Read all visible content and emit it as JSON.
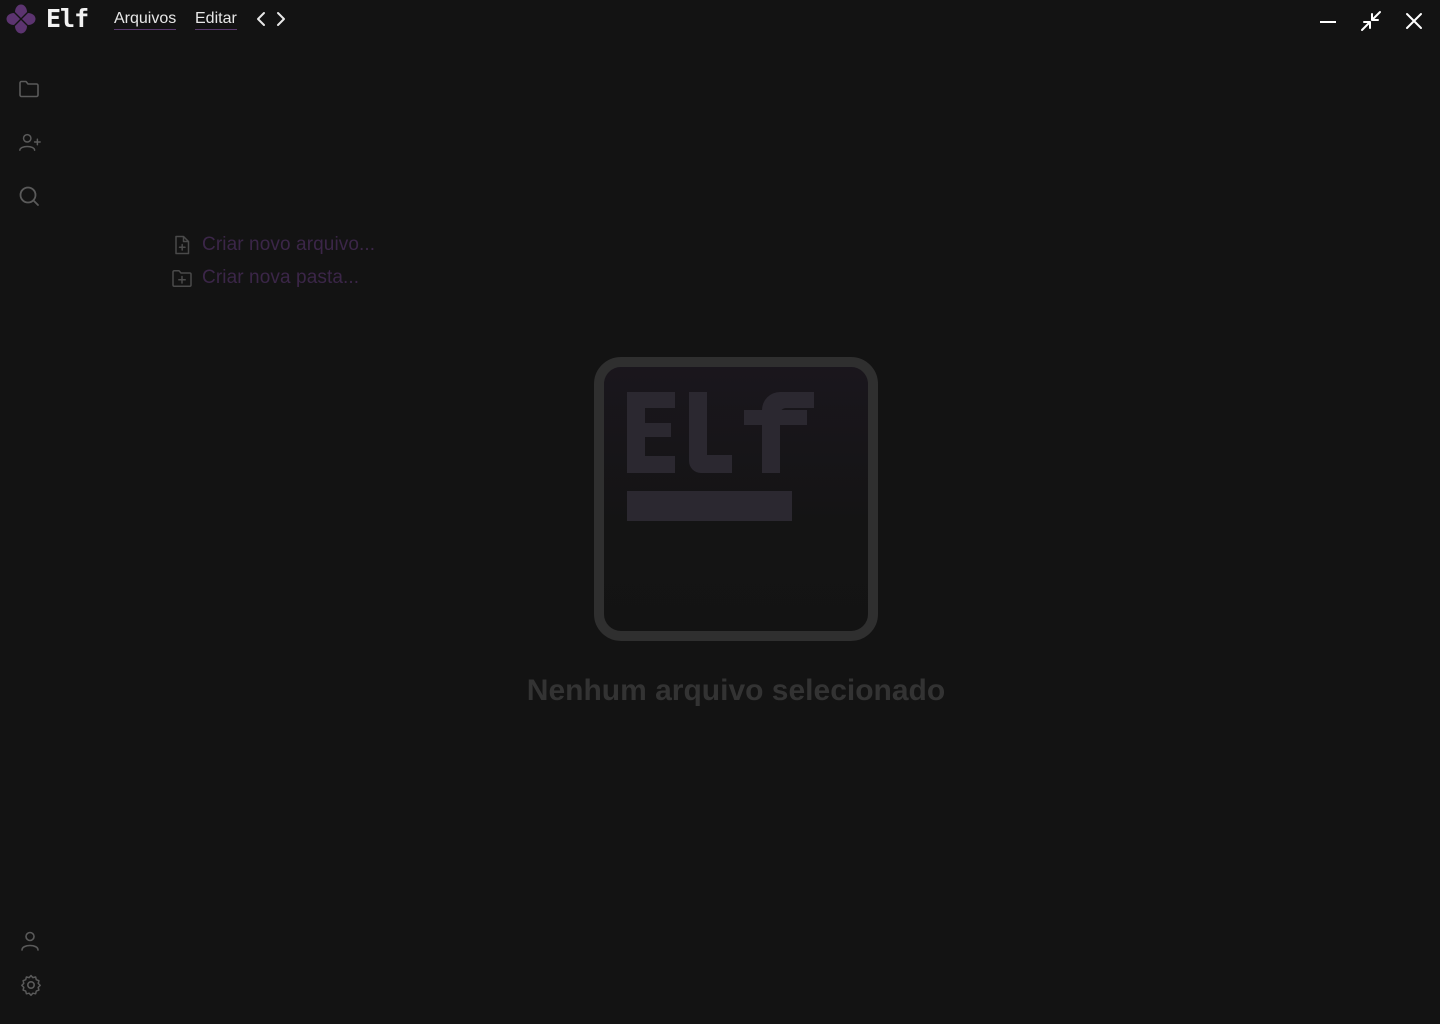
{
  "app": {
    "name": "Elf",
    "logo_color": "#5c3470"
  },
  "menu": {
    "items": [
      {
        "label": "Arquivos"
      },
      {
        "label": "Editar"
      }
    ]
  },
  "window_controls": {
    "minimize_icon": "minus-icon",
    "restore_icon": "collapse-arrows-icon",
    "close_icon": "x-icon"
  },
  "sidebar": {
    "top_icons": [
      "folder-icon",
      "user-plus-icon",
      "search-icon"
    ],
    "bottom_icons": [
      "user-icon",
      "gear-icon"
    ]
  },
  "quick_actions": {
    "new_file": "Criar novo arquivo...",
    "new_folder": "Criar nova pasta..."
  },
  "empty_state": {
    "logo_text": "Elf",
    "message": "Nenhum arquivo selecionado"
  },
  "colors": {
    "background": "#131313",
    "accent_purple": "#3b2648",
    "muted_text": "#333333"
  }
}
